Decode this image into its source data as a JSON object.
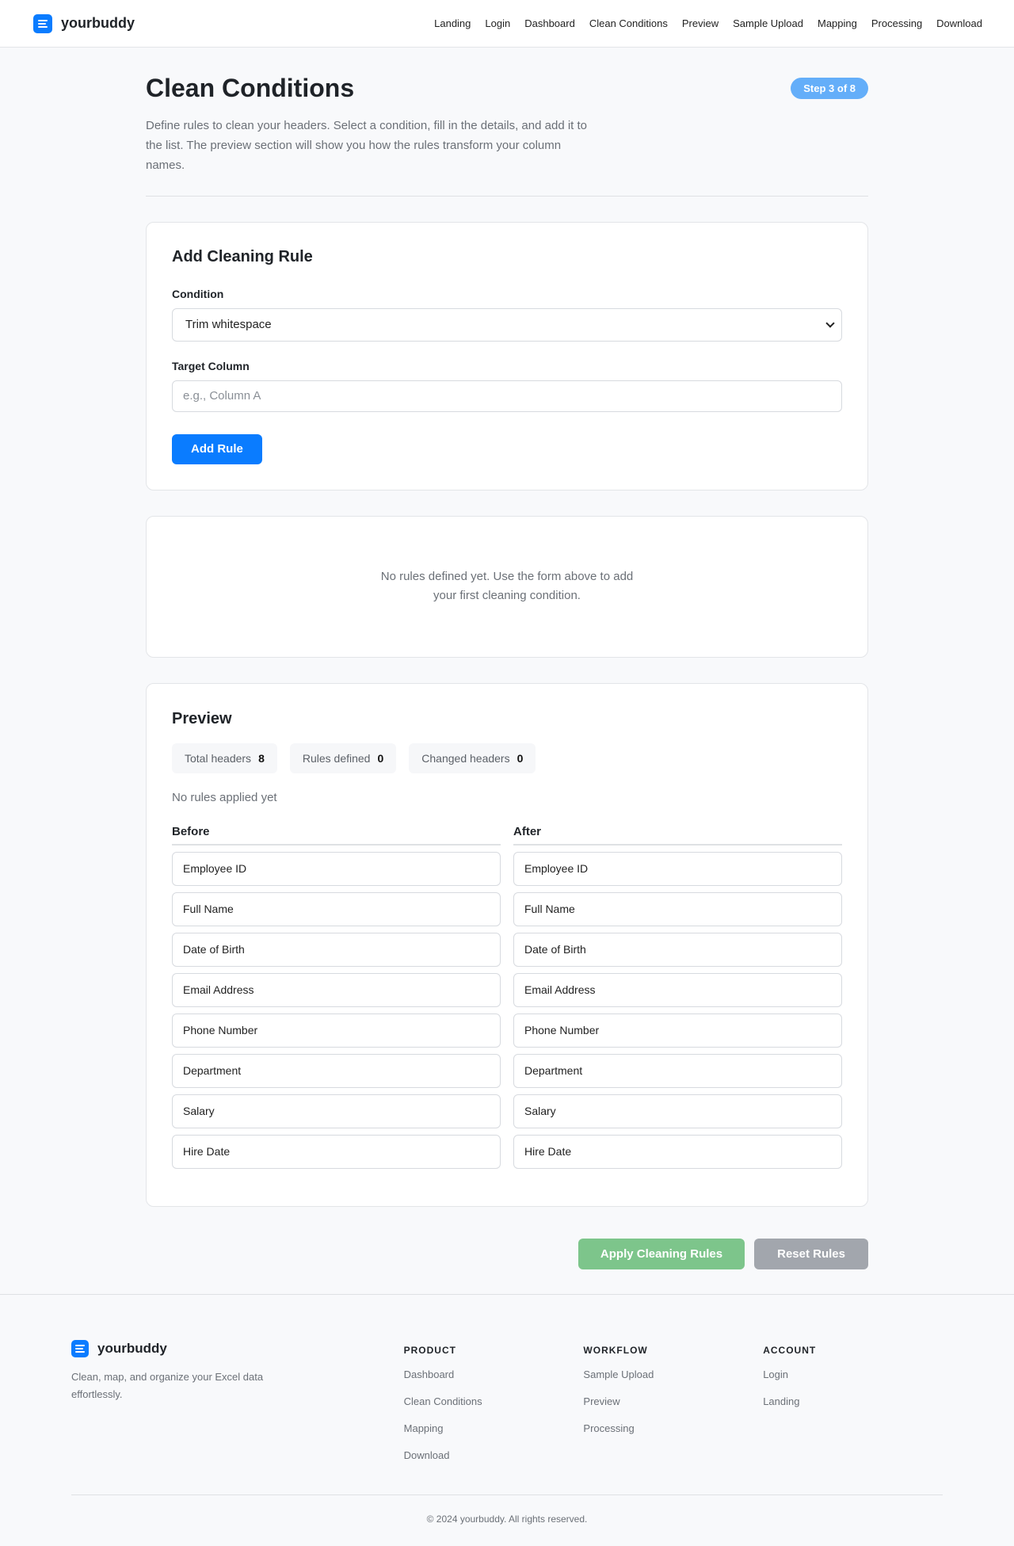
{
  "header": {
    "brand": "yourbuddy",
    "nav": [
      "Landing",
      "Login",
      "Dashboard",
      "Clean Conditions",
      "Preview",
      "Sample Upload",
      "Mapping",
      "Processing",
      "Download"
    ]
  },
  "page": {
    "title": "Clean Conditions",
    "description": "Define rules to clean your headers. Select a condition, fill in the details, and add it to the list. The preview section will show you how the rules transform your column names.",
    "step_badge": "Step 3 of 8"
  },
  "form": {
    "title": "Add Cleaning Rule",
    "condition_label": "Condition",
    "condition_value": "Trim whitespace",
    "target_label": "Target Column",
    "target_placeholder": "e.g., Column A",
    "add_button": "Add Rule"
  },
  "rules": {
    "empty_message": "No rules defined yet. Use the form above to add your first cleaning condition."
  },
  "preview": {
    "title": "Preview",
    "stats": {
      "total_label": "Total headers",
      "total_value": "8",
      "rules_label": "Rules defined",
      "rules_value": "0",
      "changed_label": "Changed headers",
      "changed_value": "0"
    },
    "status": "No rules applied yet",
    "before_label": "Before",
    "after_label": "After",
    "before": [
      "Employee ID",
      "Full Name",
      "Date of Birth",
      "Email Address",
      "Phone Number",
      "Department",
      "Salary",
      "Hire Date"
    ],
    "after": [
      "Employee ID",
      "Full Name",
      "Date of Birth",
      "Email Address",
      "Phone Number",
      "Department",
      "Salary",
      "Hire Date"
    ]
  },
  "actions": {
    "apply": "Apply Cleaning Rules",
    "reset": "Reset Rules"
  },
  "footer": {
    "brand": "yourbuddy",
    "tagline": "Clean, map, and organize your Excel data effortlessly.",
    "columns": [
      {
        "title": "PRODUCT",
        "links": [
          "Dashboard",
          "Clean Conditions",
          "Mapping",
          "Download"
        ]
      },
      {
        "title": "WORKFLOW",
        "links": [
          "Sample Upload",
          "Preview",
          "Processing"
        ]
      },
      {
        "title": "ACCOUNT",
        "links": [
          "Login",
          "Landing"
        ]
      }
    ],
    "copyright": "© 2024 yourbuddy. All rights reserved."
  },
  "colors": {
    "primary": "#0a7cff",
    "step_badge": "#64aef9",
    "apply": "#7dc58b",
    "reset": "#a2a6ad"
  }
}
